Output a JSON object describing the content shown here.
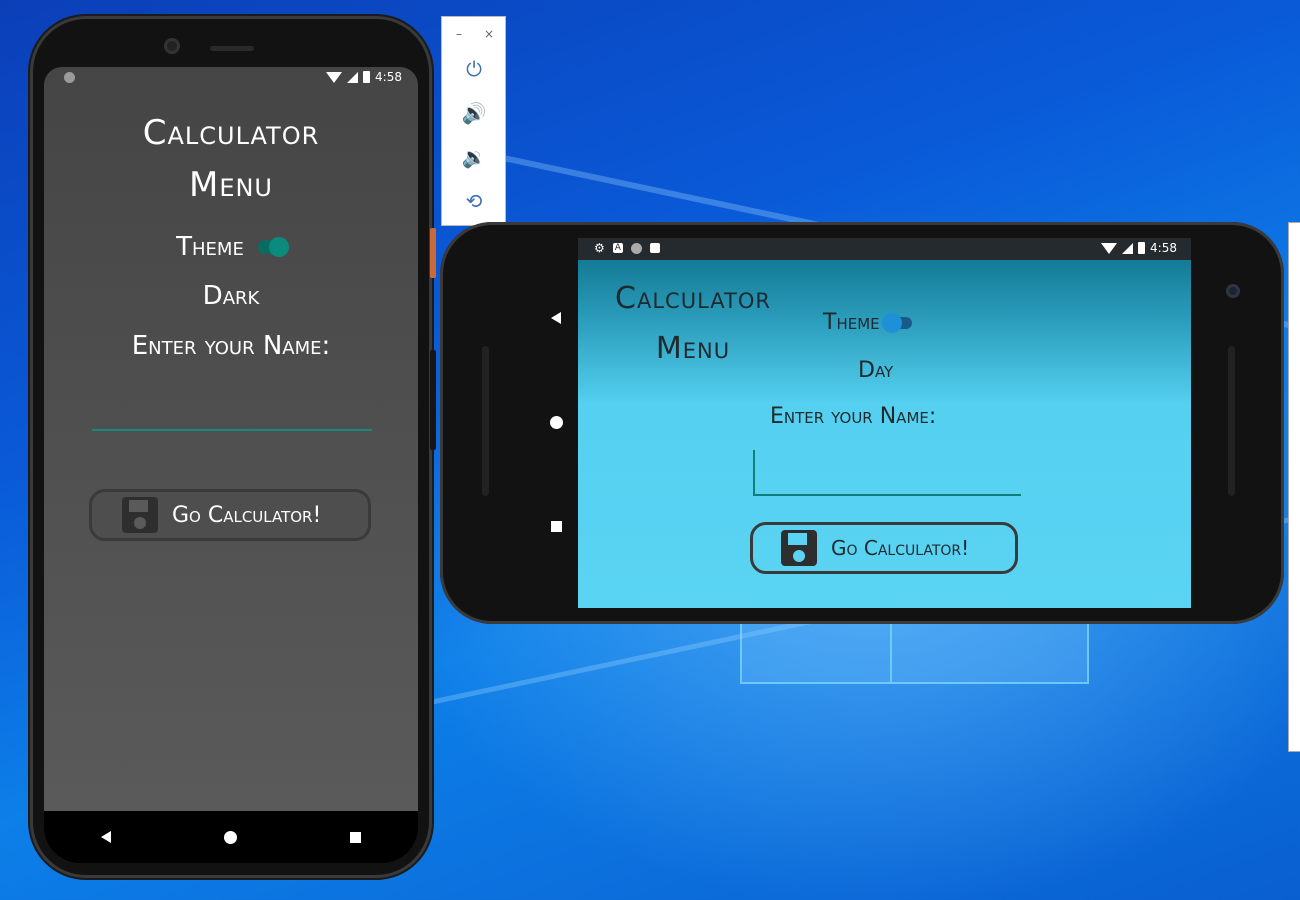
{
  "portrait": {
    "status_time": "4:58",
    "title_line1": "Calculator",
    "title_line2": "Menu",
    "theme_label": "Theme",
    "theme_toggle_on": true,
    "theme_mode": "Dark",
    "enter_name_label": "Enter your Name:",
    "name_value": "",
    "go_button_label": "Go Calculator!",
    "colors": {
      "background": "#4e4e4e",
      "accent": "#0b8b7e",
      "text": "#ffffff"
    }
  },
  "landscape": {
    "status_time": "4:58",
    "title_line1": "Calculator",
    "title_line2": "Menu",
    "theme_label": "Theme",
    "theme_toggle_on": false,
    "theme_mode": "Day",
    "enter_name_label": "Enter your Name:",
    "name_value": "",
    "go_button_label": "Go Calculator!",
    "colors": {
      "background": "#5bd4f3",
      "accent": "#1e90d8",
      "text": "#1e2a2e"
    }
  },
  "toolbar": {
    "items": [
      "power-icon",
      "volume-up-icon",
      "volume-down-icon",
      "rotate-icon"
    ],
    "minimize_glyph": "–",
    "close_glyph": "×"
  },
  "icons": {
    "power": "⏻",
    "volume_up": "🔊",
    "volume_down": "🔉",
    "rotate": "⟲",
    "status_gear": "⚙",
    "status_a": "A"
  }
}
